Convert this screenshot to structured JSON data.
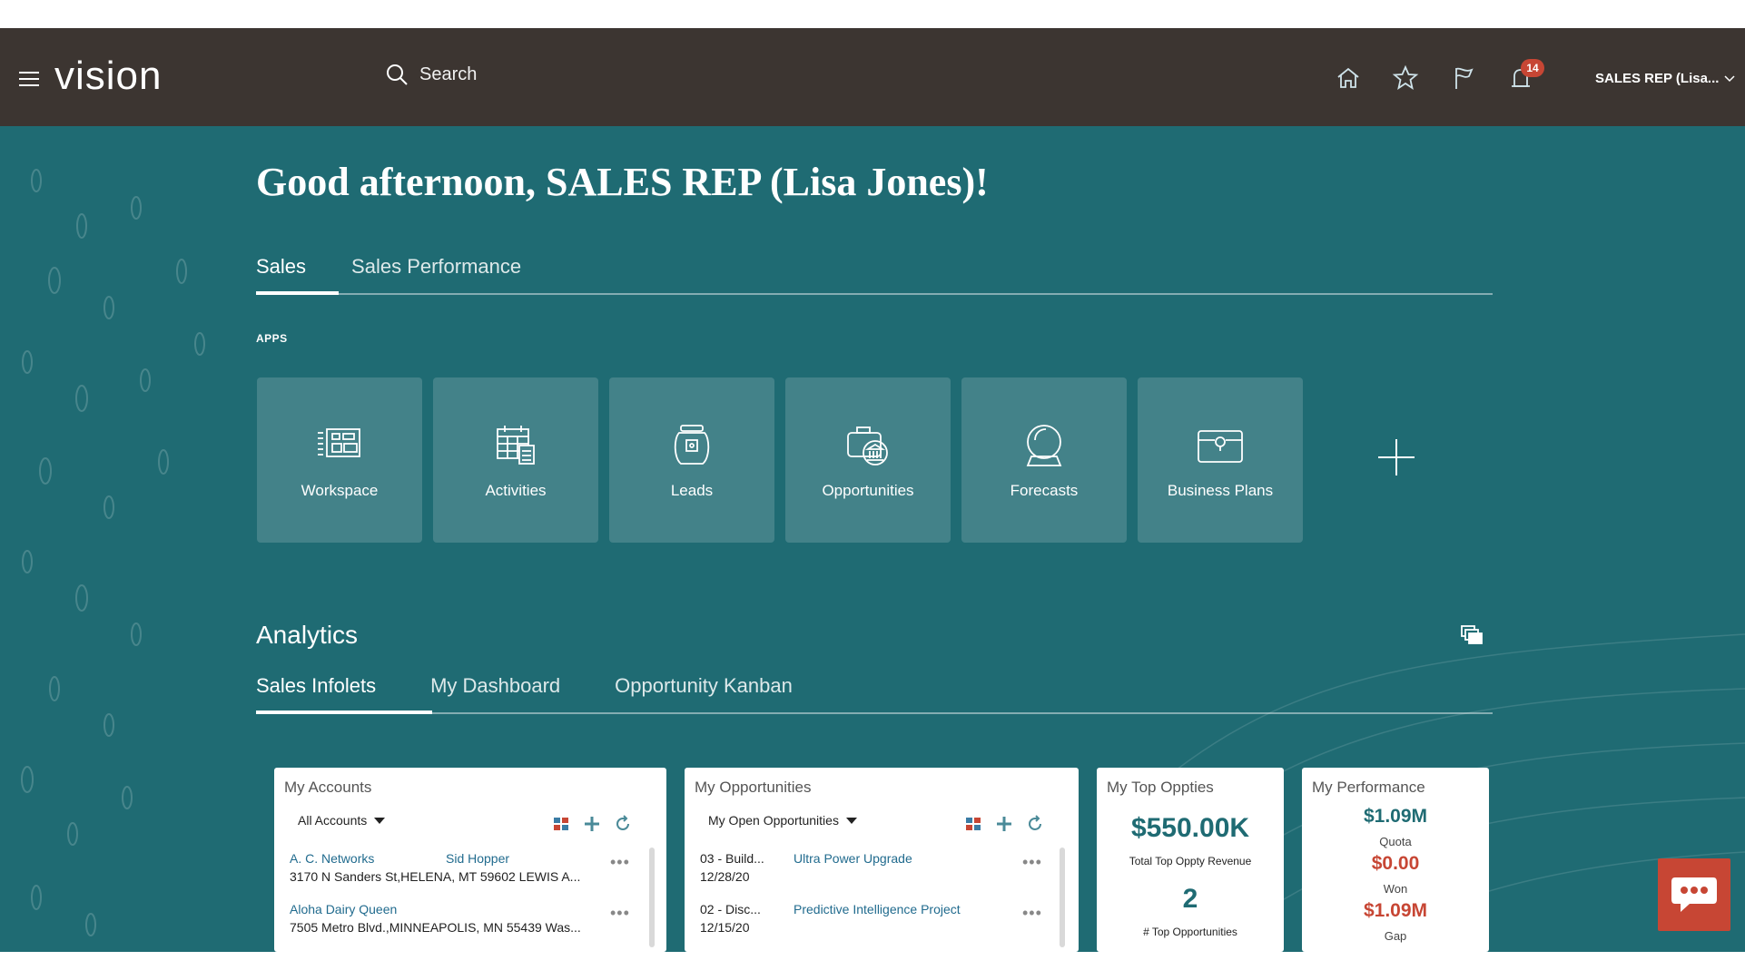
{
  "header": {
    "logo": "vision",
    "search_label": "Search",
    "notification_count": "14",
    "user_label": "SALES REP (Lisa..."
  },
  "greeting": "Good afternoon, SALES REP (Lisa Jones)!",
  "main_tabs": [
    {
      "label": "Sales",
      "active": true
    },
    {
      "label": "Sales Performance",
      "active": false
    }
  ],
  "apps_label": "APPS",
  "apps": [
    {
      "label": "Workspace",
      "icon": "workspace-icon"
    },
    {
      "label": "Activities",
      "icon": "calendar-icon"
    },
    {
      "label": "Leads",
      "icon": "jar-icon"
    },
    {
      "label": "Opportunities",
      "icon": "bank-camera-icon"
    },
    {
      "label": "Forecasts",
      "icon": "crystal-ball-icon"
    },
    {
      "label": "Business Plans",
      "icon": "briefcase-icon"
    }
  ],
  "analytics": {
    "title": "Analytics",
    "tabs": [
      {
        "label": "Sales Infolets",
        "active": true
      },
      {
        "label": "My Dashboard",
        "active": false
      },
      {
        "label": "Opportunity Kanban",
        "active": false
      }
    ]
  },
  "cards": {
    "accounts": {
      "title": "My Accounts",
      "filter": "All Accounts",
      "rows": [
        {
          "name": "A. C. Networks",
          "contact": "Sid Hopper",
          "address": "3170 N Sanders St,HELENA, MT 59602 LEWIS A..."
        },
        {
          "name": "Aloha Dairy Queen",
          "contact": "",
          "address": "7505 Metro Blvd.,MINNEAPOLIS, MN 55439 Was..."
        }
      ]
    },
    "opportunities": {
      "title": "My Opportunities",
      "filter": "My Open Opportunities",
      "rows": [
        {
          "stage": "03 - Build...",
          "date": "12/28/20",
          "name": "Ultra Power Upgrade"
        },
        {
          "stage": "02 - Disc...",
          "date": "12/15/20",
          "name": "Predictive Intelligence Project"
        }
      ]
    },
    "top_oppties": {
      "title": "My Top Oppties",
      "revenue": "$550.00K",
      "revenue_label": "Total Top Oppty Revenue",
      "count": "2",
      "count_label": "# Top Opportunities"
    },
    "performance": {
      "title": "My Performance",
      "quota": "$1.09M",
      "quota_label": "Quota",
      "won": "$0.00",
      "won_label": "Won",
      "gap": "$1.09M",
      "gap_label": "Gap"
    }
  },
  "colors": {
    "header_bg": "#3c3531",
    "main_bg": "#1f6b73",
    "accent_red": "#c74634",
    "link": "#216b8e"
  }
}
